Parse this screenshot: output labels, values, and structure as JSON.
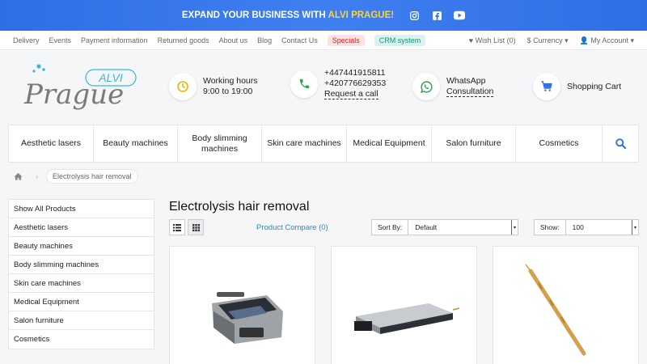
{
  "promo": {
    "text": "EXPAND YOUR BUSINESS WITH",
    "highlight": "ALVI PRAGUE!",
    "icons": [
      "instagram-icon",
      "facebook-icon",
      "youtube-icon"
    ]
  },
  "topnav": {
    "links": [
      "Delivery",
      "Events",
      "Payment information",
      "Returned goods",
      "About us",
      "Blog",
      "Contact Us"
    ],
    "specials": "Specials",
    "crm": "CRM system",
    "wishlist": "Wish List (0)",
    "currency": "$ Currency",
    "account": "My Account"
  },
  "logo": {
    "top": "ALVI",
    "main": "Prague"
  },
  "header": {
    "hours_title": "Working hours",
    "hours_value": "9:00 to 19:00",
    "phone1": "+447441915811",
    "phone2": "+420776629353",
    "request_call": "Request a call",
    "whatsapp_title": "WhatsApp",
    "whatsapp_sub": "Consultation",
    "cart": "Shopping Cart"
  },
  "categories": [
    "Aesthetic lasers",
    "Beauty machines",
    "Body slimming machines",
    "Skin care machines",
    "Medical Equipment",
    "Salon furniture",
    "Cosmetics"
  ],
  "breadcrumb": {
    "current": "Electrolysis hair removal"
  },
  "sidebar": [
    "Show All Products",
    "Aesthetic lasers",
    "Beauty machines",
    "Body slimming machines",
    "Skin care machines",
    "Medical Equipment",
    "Salon furniture",
    "Cosmetics"
  ],
  "page": {
    "title": "Electrolysis hair removal"
  },
  "toolbar": {
    "compare": "Product Compare (0)",
    "sort_label": "Sort By:",
    "sort_value": "Default",
    "show_label": "Show:",
    "show_value": "100"
  },
  "colors": {
    "accent": "#2f6fe6",
    "yellow": "#f2b300",
    "green": "#22a84a"
  }
}
